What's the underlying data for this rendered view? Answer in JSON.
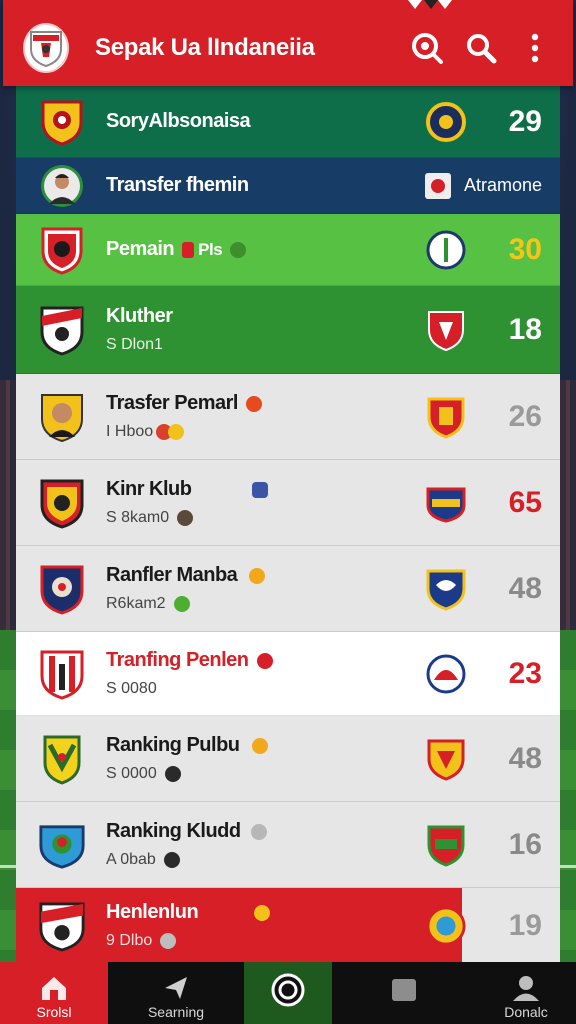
{
  "header": {
    "title": "Sepak Ua lIndaneiia",
    "icons": [
      "logo-crest-icon",
      "live-search-icon",
      "search-icon",
      "more-vertical-icon"
    ]
  },
  "rows": [
    {
      "title": "SoryAlbsonaisa",
      "sub": "",
      "stat": "29",
      "stat_color": "#ffffff",
      "theme": "dark-green"
    },
    {
      "title": "Transfer fhemin",
      "sub": "",
      "stat": "Atramone",
      "stat_color": "#ffffff",
      "theme": "navy"
    },
    {
      "title": "Pemain",
      "title_extra": "Pls",
      "sub": "",
      "stat": "30",
      "stat_color": "#f5c518",
      "theme": "light-green"
    },
    {
      "title": "Kluther",
      "sub": "S Dlon1",
      "stat": "18",
      "stat_color": "#ffffff",
      "theme": "green"
    },
    {
      "title": "Trasfer Pemarl",
      "sub": "I Hboo",
      "stat": "26",
      "stat_color": "#9a9a9a",
      "theme": "gray"
    },
    {
      "title": "Kinr Klub",
      "sub": "S 8kam0",
      "stat": "65",
      "stat_color": "#d61f26",
      "theme": "gray"
    },
    {
      "title": "Ranfler Manba",
      "sub": "R6kam2",
      "stat": "48",
      "stat_color": "#8a8a8a",
      "theme": "gray"
    },
    {
      "title": "Tranfing Penlen",
      "sub": "S 0080",
      "stat": "23",
      "stat_color": "#d61f26",
      "theme": "white-red"
    },
    {
      "title": "Ranking Pulbu",
      "sub": "S 0000",
      "stat": "48",
      "stat_color": "#8a8a8a",
      "theme": "gray"
    },
    {
      "title": "Ranking Kludd",
      "sub": "A 0bab",
      "stat": "16",
      "stat_color": "#8a8a8a",
      "theme": "gray"
    },
    {
      "title": "Henlenlun",
      "sub": "9 Dlbo",
      "stat": "19",
      "stat_color": "#9a9a9a",
      "theme": "red-split"
    }
  ],
  "nav": {
    "items": [
      {
        "label": "Srolsl"
      },
      {
        "label": "Searning"
      },
      {
        "label": ""
      },
      {
        "label": ""
      },
      {
        "label": "Donalc"
      }
    ]
  },
  "colors": {
    "brand_red": "#d61f26",
    "dark_green": "#0f6e4a",
    "navy": "#173d66",
    "light_green": "#57c143",
    "green": "#2e9132",
    "row_gray": "#e6e6e6"
  }
}
